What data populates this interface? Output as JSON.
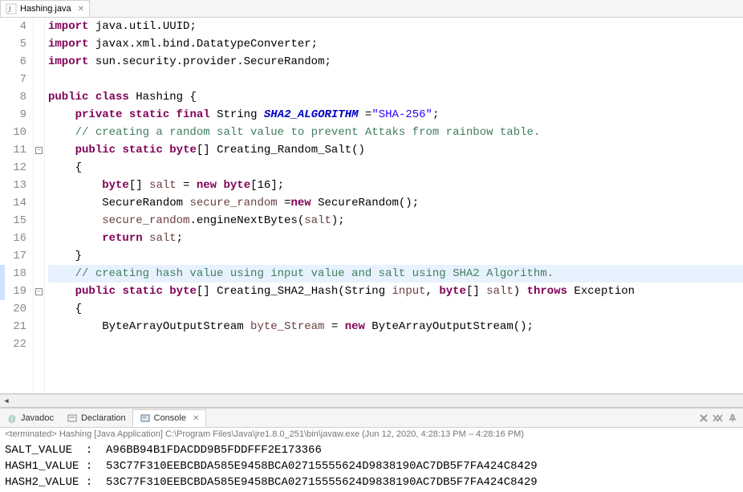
{
  "tab": {
    "filename": "Hashing.java"
  },
  "code": {
    "lines": [
      {
        "n": 4,
        "tokens": [
          [
            "kw",
            "import"
          ],
          [
            "",
            " java.util.UUID;"
          ]
        ]
      },
      {
        "n": 5,
        "tokens": [
          [
            "kw",
            "import"
          ],
          [
            "",
            " javax.xml.bind.DatatypeConverter;"
          ]
        ]
      },
      {
        "n": 6,
        "tokens": [
          [
            "kw",
            "import"
          ],
          [
            "",
            " sun.security.provider.SecureRandom;"
          ]
        ]
      },
      {
        "n": 7,
        "tokens": [
          [
            "",
            ""
          ]
        ]
      },
      {
        "n": 8,
        "tokens": [
          [
            "kw",
            "public"
          ],
          [
            "",
            " "
          ],
          [
            "kw",
            "class"
          ],
          [
            "",
            " Hashing {"
          ]
        ]
      },
      {
        "n": 9,
        "tokens": [
          [
            "",
            "    "
          ],
          [
            "kw",
            "private"
          ],
          [
            "",
            " "
          ],
          [
            "kw",
            "static"
          ],
          [
            "",
            " "
          ],
          [
            "kw",
            "final"
          ],
          [
            "",
            " String "
          ],
          [
            "fld",
            "SHA2_ALGORITHM"
          ],
          [
            "",
            " ="
          ],
          [
            "str",
            "\"SHA-256\""
          ],
          [
            "",
            ";"
          ]
        ]
      },
      {
        "n": 10,
        "tokens": [
          [
            "",
            "    "
          ],
          [
            "cm",
            "// creating a random salt value to prevent Attaks from rainbow table."
          ]
        ]
      },
      {
        "n": 11,
        "marker": "fold",
        "tokens": [
          [
            "",
            "    "
          ],
          [
            "kw",
            "public"
          ],
          [
            "",
            " "
          ],
          [
            "kw",
            "static"
          ],
          [
            "",
            " "
          ],
          [
            "kw",
            "byte"
          ],
          [
            "",
            "[] Creating_Random_Salt()"
          ]
        ]
      },
      {
        "n": 12,
        "tokens": [
          [
            "",
            "    {"
          ]
        ]
      },
      {
        "n": 13,
        "tokens": [
          [
            "",
            "        "
          ],
          [
            "kw",
            "byte"
          ],
          [
            "",
            "[] "
          ],
          [
            "lvar",
            "salt"
          ],
          [
            "",
            " = "
          ],
          [
            "kw",
            "new"
          ],
          [
            "",
            " "
          ],
          [
            "kw",
            "byte"
          ],
          [
            "",
            "[16];"
          ]
        ]
      },
      {
        "n": 14,
        "tokens": [
          [
            "",
            "        SecureRandom "
          ],
          [
            "lvar",
            "secure_random"
          ],
          [
            "",
            " ="
          ],
          [
            "kw",
            "new"
          ],
          [
            "",
            " SecureRandom();"
          ]
        ]
      },
      {
        "n": 15,
        "tokens": [
          [
            "",
            "        "
          ],
          [
            "lvar",
            "secure_random"
          ],
          [
            "",
            ".engineNextBytes("
          ],
          [
            "lvar",
            "salt"
          ],
          [
            "",
            ");"
          ]
        ]
      },
      {
        "n": 16,
        "tokens": [
          [
            "",
            "        "
          ],
          [
            "kw",
            "return"
          ],
          [
            "",
            " "
          ],
          [
            "lvar",
            "salt"
          ],
          [
            "",
            ";"
          ]
        ]
      },
      {
        "n": 17,
        "tokens": [
          [
            "",
            "    }"
          ]
        ]
      },
      {
        "n": 18,
        "hl": true,
        "tokens": [
          [
            "",
            "    "
          ],
          [
            "cm",
            "// creating hash value using input value and salt using SHA2 Algorithm."
          ]
        ]
      },
      {
        "n": 19,
        "marker": "fold",
        "tokens": [
          [
            "",
            "    "
          ],
          [
            "kw",
            "public"
          ],
          [
            "",
            " "
          ],
          [
            "kw",
            "static"
          ],
          [
            "",
            " "
          ],
          [
            "kw",
            "byte"
          ],
          [
            "",
            "[] Creating_SHA2_Hash(String "
          ],
          [
            "param",
            "input"
          ],
          [
            "",
            ", "
          ],
          [
            "kw",
            "byte"
          ],
          [
            "",
            "[] "
          ],
          [
            "param",
            "salt"
          ],
          [
            "",
            ") "
          ],
          [
            "kw",
            "throws"
          ],
          [
            "",
            " Exception"
          ]
        ]
      },
      {
        "n": 20,
        "tokens": [
          [
            "",
            "    {"
          ]
        ]
      },
      {
        "n": 21,
        "tokens": [
          [
            "",
            "        ByteArrayOutputStream "
          ],
          [
            "lvar",
            "byte_Stream"
          ],
          [
            "",
            " = "
          ],
          [
            "kw",
            "new"
          ],
          [
            "",
            " ByteArrayOutputStream();"
          ]
        ]
      },
      {
        "n": 22,
        "tokens": [
          [
            "",
            ""
          ]
        ]
      }
    ]
  },
  "views": {
    "javadoc": "Javadoc",
    "declaration": "Declaration",
    "console": "Console"
  },
  "console": {
    "status": "<terminated> Hashing [Java Application] C:\\Program Files\\Java\\jre1.8.0_251\\bin\\javaw.exe  (Jun 12, 2020, 4:28:13 PM – 4:28:16 PM)",
    "lines": [
      "SALT_VALUE  :  A96BB94B1FDACDD9B5FDDFFF2E173366",
      "HASH1_VALUE :  53C77F310EEBCBDA585E9458BCA02715555624D9838190AC7DB5F7FA424C8429",
      "HASH2_VALUE :  53C77F310EEBCBDA585E9458BCA02715555624D9838190AC7DB5F7FA424C8429"
    ]
  },
  "icons": {
    "remove_launch": "x",
    "remove_all": "xx",
    "pin": "pin"
  }
}
